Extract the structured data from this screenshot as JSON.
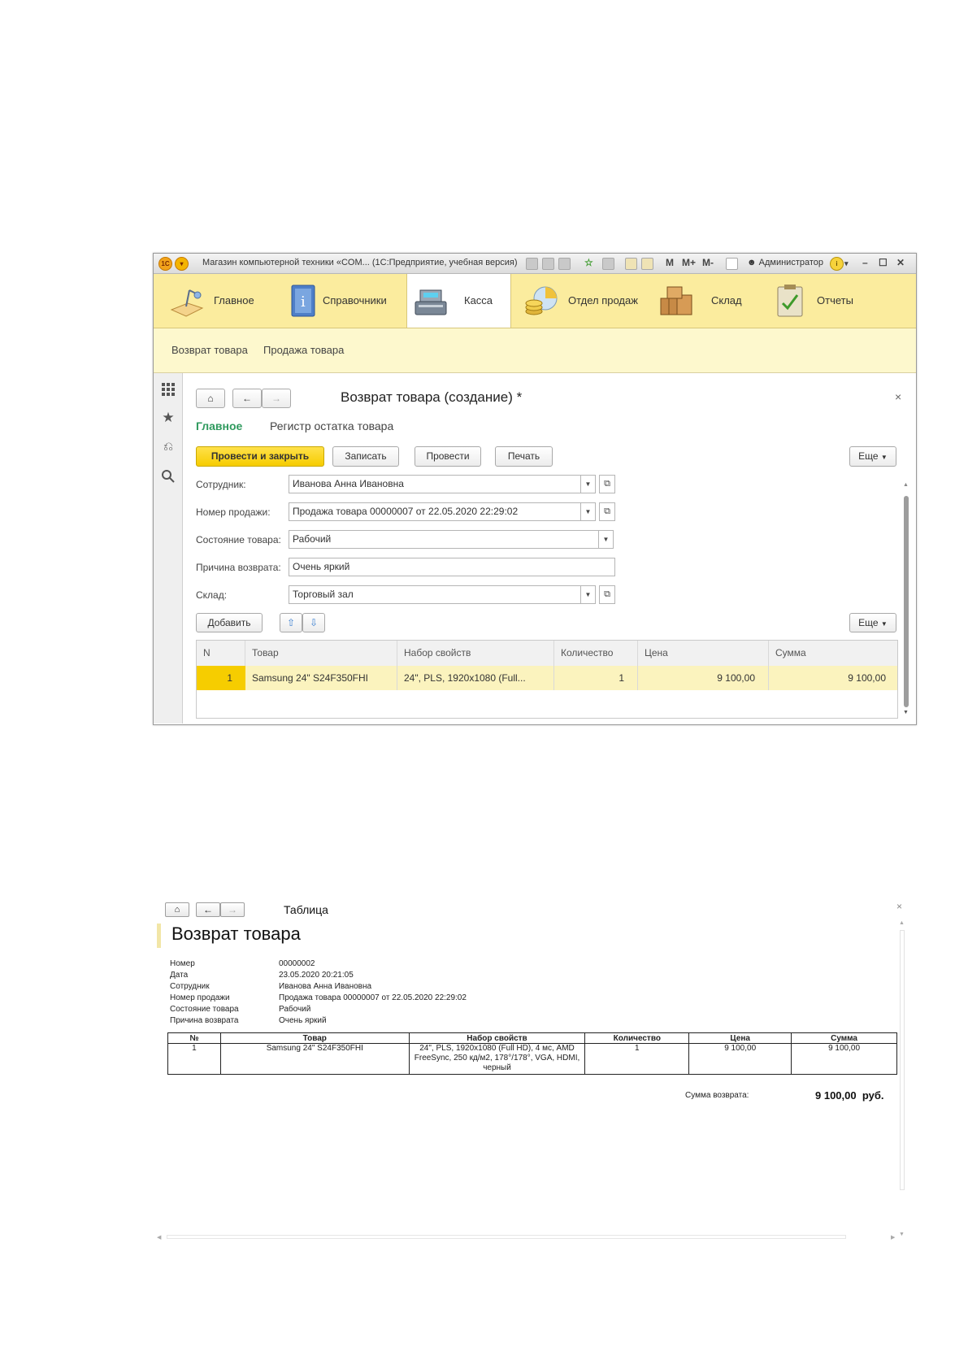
{
  "window1": {
    "title": "Магазин компьютерной техники «COM... (1С:Предприятие, учебная версия)",
    "user": "Администратор",
    "toolbar_glyphs": {
      "m": "M",
      "mplus": "M+",
      "mminus": "M-"
    },
    "sections": [
      {
        "label": "Главное",
        "icon": "desk-lamp-icon"
      },
      {
        "label": "Справочники",
        "icon": "info-book-icon"
      },
      {
        "label": "Касса",
        "icon": "cash-register-icon"
      },
      {
        "label": "Отдел продаж",
        "icon": "coins-chart-icon"
      },
      {
        "label": "Склад",
        "icon": "boxes-icon"
      },
      {
        "label": "Отчеты",
        "icon": "clipboard-icon"
      }
    ],
    "active_section": "Касса",
    "subsections": [
      "Возврат товара",
      "Продажа товара"
    ],
    "form": {
      "title": "Возврат товара (создание) *",
      "tabs": [
        "Главное",
        "Регистр остатка товара"
      ],
      "buttons": {
        "post_close": "Провести и закрыть",
        "save": "Записать",
        "post": "Провести",
        "print": "Печать",
        "more": "Еще"
      },
      "fields": [
        {
          "label": "Сотрудник:",
          "value": "Иванова Анна Ивановна"
        },
        {
          "label": "Номер продажи:",
          "value": "Продажа товара 00000007 от 22.05.2020 22:29:02"
        },
        {
          "label": "Состояние товара:",
          "value": "Рабочий"
        },
        {
          "label": "Причина возврата:",
          "value": "Очень яркий"
        },
        {
          "label": "Склад:",
          "value": "Торговый зал"
        }
      ],
      "table_buttons": {
        "add": "Добавить",
        "more": "Еще"
      },
      "table": {
        "headers": [
          "N",
          "Товар",
          "Набор свойств",
          "Количество",
          "Цена",
          "Сумма"
        ],
        "rows": [
          [
            "1",
            "Samsung 24\" S24F350FHI",
            "24\", PLS, 1920x1080 (Full...",
            "1",
            "9 100,00",
            "9 100,00"
          ]
        ]
      }
    }
  },
  "window2": {
    "title": "Таблица",
    "report_title": "Возврат товара",
    "details": [
      {
        "label": "Номер",
        "value": "00000002"
      },
      {
        "label": "Дата",
        "value": "23.05.2020 20:21:05"
      },
      {
        "label": "Сотрудник",
        "value": "Иванова Анна Ивановна"
      },
      {
        "label": "Номер продажи",
        "value": "Продажа товара 00000007 от 22.05.2020 22:29:02"
      },
      {
        "label": "Состояние товара",
        "value": "Рабочий"
      },
      {
        "label": "Причина возврата",
        "value": "Очень яркий"
      }
    ],
    "table": {
      "headers": [
        "№",
        "Товар",
        "Набор свойств",
        "Количество",
        "Цена",
        "Сумма"
      ],
      "rows": [
        [
          "1",
          "Samsung 24\" S24F350FHI",
          "24\", PLS, 1920x1080 (Full HD), 4 мс, AMD FreeSync, 250 кд/м2, 178°/178°, VGA, HDMI, черный",
          "1",
          "9 100,00",
          "9 100,00"
        ]
      ]
    },
    "total_label": "Сумма возврата:",
    "total_value": "9 100,00",
    "currency": "руб."
  }
}
